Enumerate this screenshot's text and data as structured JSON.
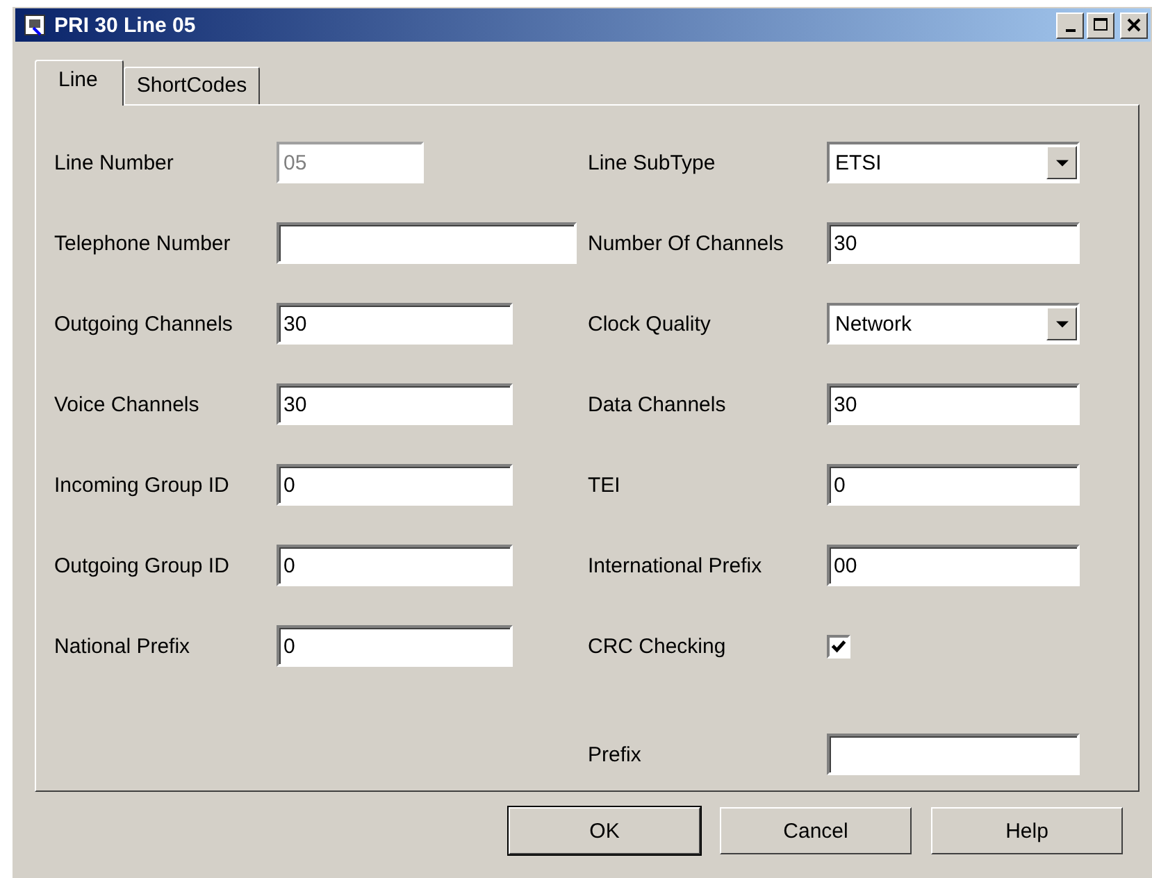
{
  "window": {
    "title": "PRI 30 Line 05"
  },
  "tabs": [
    {
      "label": "Line",
      "selected": true
    },
    {
      "label": "ShortCodes",
      "selected": false
    }
  ],
  "left_fields": [
    {
      "label": "Line Number",
      "kind": "text",
      "value": "05",
      "disabled": true
    },
    {
      "label": "Telephone Number",
      "kind": "text",
      "disabled": false
    },
    {
      "label": "Outgoing Channels",
      "kind": "text",
      "value": "30",
      "disabled": false
    },
    {
      "label": "Voice Channels",
      "kind": "text",
      "value": "30",
      "disabled": false
    },
    {
      "label": "Incoming Group ID",
      "kind": "text",
      "value": "0",
      "disabled": false
    },
    {
      "label": "Outgoing Group ID",
      "kind": "text",
      "value": "0",
      "disabled": false
    },
    {
      "label": "National Prefix",
      "kind": "text",
      "value": "0",
      "disabled": false
    }
  ],
  "right_fields": [
    {
      "label": "Line SubType",
      "kind": "dropdown",
      "value": "ETSI"
    },
    {
      "label": "Number Of Channels",
      "kind": "text",
      "value": "30",
      "disabled": false
    },
    {
      "label": "Clock Quality",
      "kind": "dropdown",
      "value": "Network"
    },
    {
      "label": "Data Channels",
      "kind": "text",
      "value": "30",
      "disabled": false
    },
    {
      "label": "TEI",
      "kind": "text",
      "value": "0",
      "disabled": false
    },
    {
      "label": "International Prefix",
      "kind": "text",
      "value": "00",
      "disabled": false
    },
    {
      "label": "CRC Checking",
      "kind": "checkbox",
      "checked": true
    },
    {
      "label": "Prefix",
      "kind": "text",
      "disabled": false
    }
  ],
  "buttons": [
    {
      "label": "OK",
      "default": true
    },
    {
      "label": "Cancel",
      "default": false
    },
    {
      "label": "Help",
      "default": false
    }
  ]
}
